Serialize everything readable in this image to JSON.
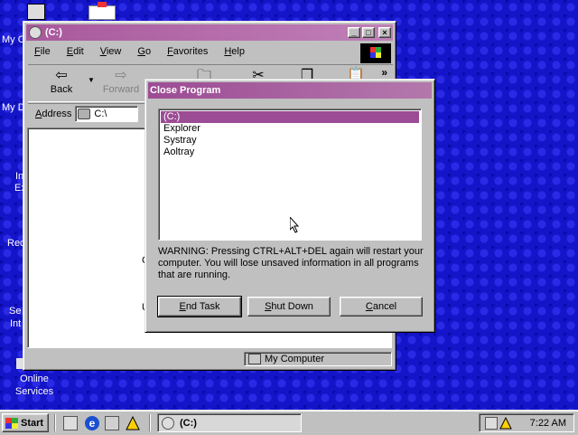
{
  "desktop": {
    "icons": [
      {
        "label": "Online Services"
      }
    ],
    "fragments": [
      "My C",
      "My D",
      "In",
      "Ex",
      "Rec",
      "Se",
      "Int"
    ]
  },
  "explorer": {
    "title": "(C:)",
    "menu": [
      "File",
      "Edit",
      "View",
      "Go",
      "Favorites",
      "Help"
    ],
    "toolbar": {
      "back": "Back",
      "forward": "Forward",
      "more": "»"
    },
    "address": {
      "label": "Address",
      "value": "C:\\"
    },
    "content_fragments": [
      "C",
      "U"
    ],
    "status": "My Computer"
  },
  "dialog": {
    "title": "Close Program",
    "processes": [
      "(C:)",
      "Explorer",
      "Systray",
      "Aoltray"
    ],
    "selected": "(C:)",
    "warning": "WARNING: Pressing CTRL+ALT+DEL again will restart your computer. You will lose unsaved information in all programs that are running.",
    "buttons": {
      "end_task": "End Task",
      "shut_down": "Shut Down",
      "cancel": "Cancel"
    }
  },
  "taskbar": {
    "start": "Start",
    "task": "(C:)",
    "clock": "7:22 AM"
  }
}
